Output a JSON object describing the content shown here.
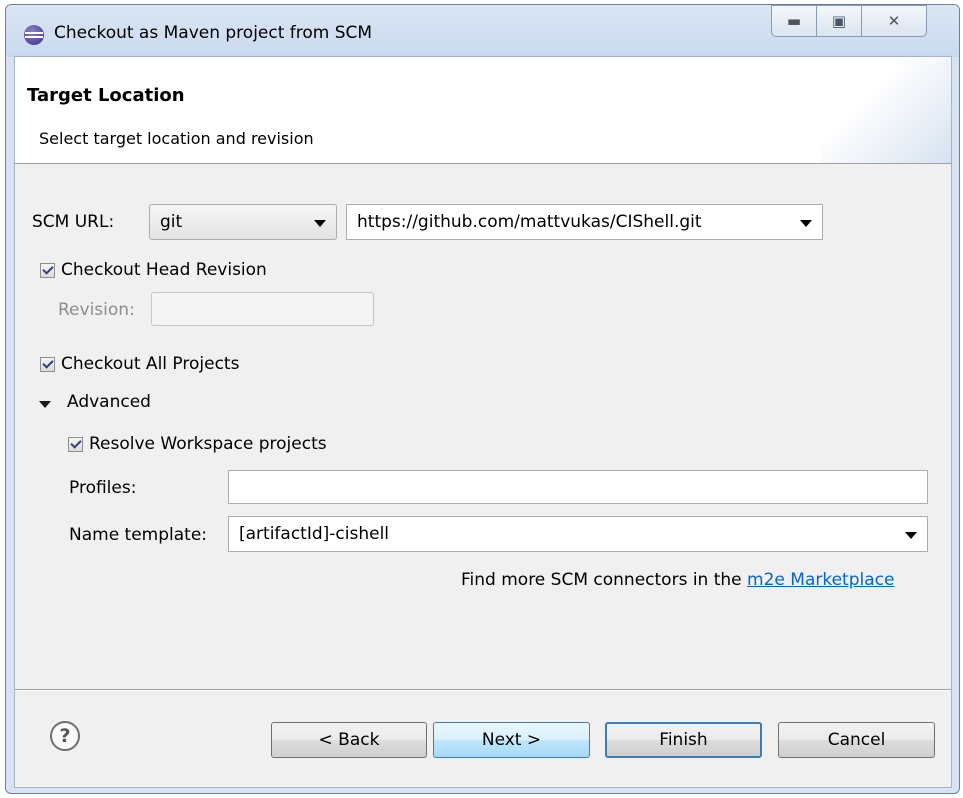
{
  "window": {
    "title": "Checkout as Maven project from SCM"
  },
  "header": {
    "title": "Target Location",
    "subtitle": "Select target location and revision"
  },
  "scm": {
    "label": "SCM URL:",
    "type_value": "git",
    "url_value": "https://github.com/mattvukas/CIShell.git"
  },
  "checkout_head": {
    "label": "Checkout Head Revision",
    "checked": true
  },
  "revision": {
    "label": "Revision:",
    "value": ""
  },
  "checkout_all": {
    "label": "Checkout All Projects",
    "checked": true
  },
  "advanced": {
    "label": "Advanced",
    "expanded": true,
    "resolve_workspace": {
      "label": "Resolve Workspace projects",
      "checked": true
    },
    "profiles": {
      "label": "Profiles:",
      "value": ""
    },
    "name_template": {
      "label": "Name template:",
      "value": "[artifactId]-cishell"
    }
  },
  "connectors": {
    "text": "Find more SCM connectors in the",
    "link": "m2e Marketplace"
  },
  "buttons": {
    "back": "< Back",
    "next": "Next >",
    "finish": "Finish",
    "cancel": "Cancel"
  },
  "icons": {
    "app": "eclipse-icon",
    "help": "help-icon",
    "minimize": "minimize-icon",
    "maximize": "maximize-icon",
    "close": "close-icon"
  }
}
